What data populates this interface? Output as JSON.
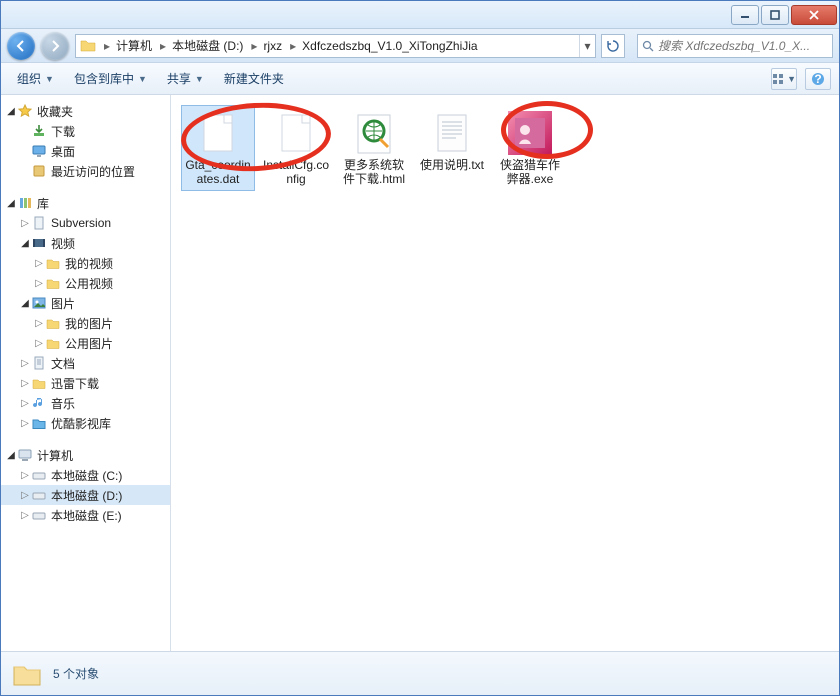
{
  "titlebar": {
    "min_tip": "最小化",
    "max_tip": "最大化",
    "close_tip": "关闭"
  },
  "nav": {
    "back_tip": "返回",
    "fwd_tip": "前进",
    "crumbs": [
      "计算机",
      "本地磁盘 (D:)",
      "rjxz",
      "Xdfczedszbq_V1.0_XiTongZhiJia"
    ],
    "refresh_tip": "刷新"
  },
  "search": {
    "placeholder": "搜索 Xdfczedszbq_V1.0_X..."
  },
  "toolbar": {
    "organize": "组织",
    "include": "包含到库中",
    "share": "共享",
    "newfolder": "新建文件夹"
  },
  "sidebar": {
    "favorites": {
      "label": "收藏夹",
      "items": [
        "下载",
        "桌面",
        "最近访问的位置"
      ]
    },
    "libraries": {
      "label": "库",
      "items": [
        {
          "label": "Subversion",
          "children": []
        },
        {
          "label": "视频",
          "children": [
            "我的视频",
            "公用视频"
          ]
        },
        {
          "label": "图片",
          "children": [
            "我的图片",
            "公用图片"
          ]
        },
        {
          "label": "文档",
          "children": []
        },
        {
          "label": "迅雷下载",
          "children": []
        },
        {
          "label": "音乐",
          "children": []
        },
        {
          "label": "优酷影视库",
          "children": []
        }
      ]
    },
    "computer": {
      "label": "计算机",
      "items": [
        "本地磁盘 (C:)",
        "本地磁盘 (D:)",
        "本地磁盘 (E:)"
      ]
    }
  },
  "files": [
    {
      "name": "Gta_coordinates.dat",
      "type": "blank",
      "selected": true
    },
    {
      "name": "InstallCfg.config",
      "type": "blank",
      "selected": false
    },
    {
      "name": "更多系统软件下载.html",
      "type": "html",
      "selected": false
    },
    {
      "name": "使用说明.txt",
      "type": "txt",
      "selected": false
    },
    {
      "name": "侠盗猎车作弊器.exe",
      "type": "exe",
      "selected": false
    }
  ],
  "status": {
    "text": "5 个对象"
  }
}
